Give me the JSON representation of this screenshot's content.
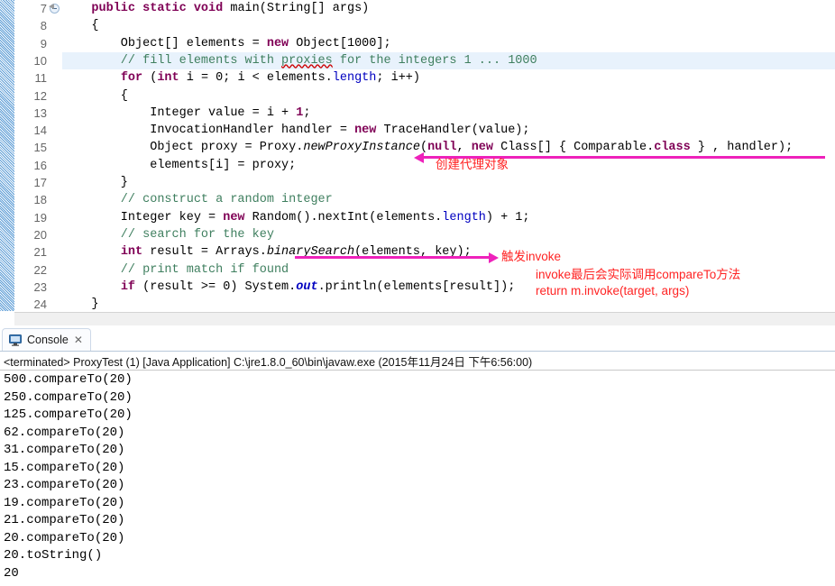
{
  "editor": {
    "first_line": 7,
    "fold_icon": "collapse-circle-icon",
    "highlight_line": 10,
    "lines": [
      {
        "n": 7,
        "tokens": [
          {
            "t": "    ",
            "c": "plain"
          },
          {
            "t": "public static void ",
            "c": "kw"
          },
          {
            "t": "main(String[] args)",
            "c": "plain"
          }
        ]
      },
      {
        "n": 8,
        "tokens": [
          {
            "t": "    {",
            "c": "plain"
          }
        ]
      },
      {
        "n": 9,
        "tokens": [
          {
            "t": "        Object[] elements = ",
            "c": "plain"
          },
          {
            "t": "new",
            "c": "kw"
          },
          {
            "t": " Object[1000];",
            "c": "plain"
          }
        ]
      },
      {
        "n": 10,
        "tokens": [
          {
            "t": "        // fill elements with ",
            "c": "cmt"
          },
          {
            "t": "proxies",
            "c": "cmt spell"
          },
          {
            "t": " for the integers 1 ... 1000",
            "c": "cmt"
          }
        ]
      },
      {
        "n": 11,
        "tokens": [
          {
            "t": "        ",
            "c": "plain"
          },
          {
            "t": "for",
            "c": "kw"
          },
          {
            "t": " (",
            "c": "plain"
          },
          {
            "t": "int",
            "c": "kw"
          },
          {
            "t": " i = 0; i < elements.",
            "c": "plain"
          },
          {
            "t": "length",
            "c": "fld"
          },
          {
            "t": "; i++)",
            "c": "plain"
          }
        ]
      },
      {
        "n": 12,
        "tokens": [
          {
            "t": "        {",
            "c": "plain"
          }
        ]
      },
      {
        "n": 13,
        "tokens": [
          {
            "t": "            Integer value = i + ",
            "c": "plain"
          },
          {
            "t": "1",
            "c": "kw"
          },
          {
            "t": ";",
            "c": "plain"
          }
        ]
      },
      {
        "n": 14,
        "tokens": [
          {
            "t": "            InvocationHandler handler = ",
            "c": "plain"
          },
          {
            "t": "new",
            "c": "kw"
          },
          {
            "t": " TraceHandler(value);",
            "c": "plain"
          }
        ]
      },
      {
        "n": 15,
        "tokens": [
          {
            "t": "            Object proxy = Proxy.",
            "c": "plain"
          },
          {
            "t": "newProxyInstance",
            "c": "mth"
          },
          {
            "t": "(",
            "c": "plain"
          },
          {
            "t": "null",
            "c": "kw"
          },
          {
            "t": ", ",
            "c": "plain"
          },
          {
            "t": "new",
            "c": "kw"
          },
          {
            "t": " Class[] { Comparable.",
            "c": "plain"
          },
          {
            "t": "class",
            "c": "kw"
          },
          {
            "t": " } , handler);",
            "c": "plain"
          }
        ]
      },
      {
        "n": 16,
        "tokens": [
          {
            "t": "            elements[i] = proxy;",
            "c": "plain"
          }
        ]
      },
      {
        "n": 17,
        "tokens": [
          {
            "t": "        }",
            "c": "plain"
          }
        ]
      },
      {
        "n": 18,
        "tokens": [
          {
            "t": "        // construct a random integer",
            "c": "cmt"
          }
        ]
      },
      {
        "n": 19,
        "tokens": [
          {
            "t": "        Integer key = ",
            "c": "plain"
          },
          {
            "t": "new",
            "c": "kw"
          },
          {
            "t": " Random().nextInt(elements.",
            "c": "plain"
          },
          {
            "t": "length",
            "c": "fld"
          },
          {
            "t": ") + 1;",
            "c": "plain"
          }
        ]
      },
      {
        "n": 20,
        "tokens": [
          {
            "t": "        // search for the key",
            "c": "cmt"
          }
        ]
      },
      {
        "n": 21,
        "tokens": [
          {
            "t": "        ",
            "c": "plain"
          },
          {
            "t": "int",
            "c": "kw"
          },
          {
            "t": " result = Arrays.",
            "c": "plain"
          },
          {
            "t": "binarySearch",
            "c": "mth"
          },
          {
            "t": "(elements, key);",
            "c": "plain"
          }
        ]
      },
      {
        "n": 22,
        "tokens": [
          {
            "t": "        // print match if found",
            "c": "cmt"
          }
        ]
      },
      {
        "n": 23,
        "tokens": [
          {
            "t": "        ",
            "c": "plain"
          },
          {
            "t": "if",
            "c": "kw"
          },
          {
            "t": " (result >= 0) System.",
            "c": "plain"
          },
          {
            "t": "out",
            "c": "stat"
          },
          {
            "t": ".println(elements[result]);",
            "c": "plain"
          }
        ]
      },
      {
        "n": 24,
        "tokens": [
          {
            "t": "    }",
            "c": "plain"
          }
        ]
      }
    ],
    "annotations": [
      {
        "id": "create-proxy",
        "text": "创建代理对象",
        "arrow": "left",
        "color": "#ff2424"
      },
      {
        "id": "trigger-invoke",
        "text": "触发invoke",
        "arrow": "right",
        "color": "#ff2424"
      },
      {
        "id": "invoke-detail-1",
        "text": "invoke最后会实际调用compareTo方法",
        "color": "#ff2424"
      },
      {
        "id": "invoke-detail-2",
        "text": "return m.invoke(target, args)",
        "color": "#ff2424"
      }
    ],
    "arrow_color": "#ee22bb",
    "highlight_color": "#e8f2fc",
    "hscroll_left_glyph": "◄"
  },
  "console": {
    "tab_label": "Console",
    "tab_icon": "monitor-icon",
    "tab_close_glyph": "✕",
    "header": "<terminated> ProxyTest (1) [Java Application] C:\\jre1.8.0_60\\bin\\javaw.exe (2015年11月24日 下午6:56:00)",
    "output": [
      "500.compareTo(20)",
      "250.compareTo(20)",
      "125.compareTo(20)",
      "62.compareTo(20)",
      "31.compareTo(20)",
      "15.compareTo(20)",
      "23.compareTo(20)",
      "19.compareTo(20)",
      "21.compareTo(20)",
      "20.compareTo(20)",
      "20.toString()",
      "20"
    ]
  }
}
